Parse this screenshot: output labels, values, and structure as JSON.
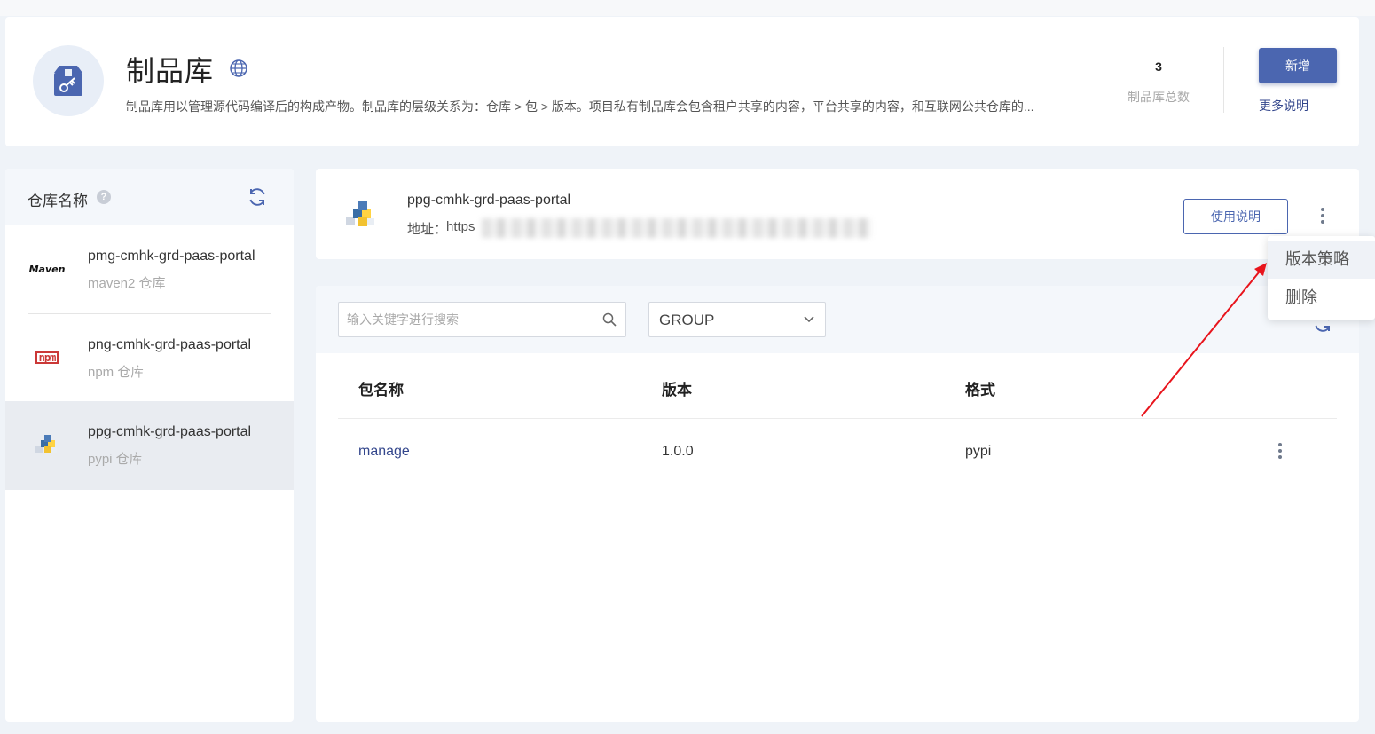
{
  "header": {
    "title": "制品库",
    "description": "制品库用以管理源代码编译后的构成产物。制品库的层级关系为：仓库 > 包 > 版本。项目私有制品库会包含租户共享的内容，平台共享的内容，和互联网公共仓库的...",
    "stat_value": "3",
    "stat_label": "制品库总数",
    "add_label": "新增",
    "more_label": "更多说明"
  },
  "sidebar": {
    "title": "仓库名称",
    "help": "?",
    "items": [
      {
        "name": "pmg-cmhk-grd-paas-portal",
        "type": "maven2 仓库",
        "logo": "Maven"
      },
      {
        "name": "png-cmhk-grd-paas-portal",
        "type": "npm 仓库",
        "logo": "npm"
      },
      {
        "name": "ppg-cmhk-grd-paas-portal",
        "type": "pypi 仓库",
        "logo": "python-icon"
      }
    ]
  },
  "repo_info": {
    "name": "ppg-cmhk-grd-paas-portal",
    "address_label": "地址：",
    "address_value": "https",
    "usage_label": "使用说明"
  },
  "dropdown": {
    "items": [
      "版本策略",
      "删除"
    ]
  },
  "packages": {
    "search_placeholder": "输入关键字进行搜索",
    "group_value": "GROUP",
    "columns": [
      "包名称",
      "版本",
      "格式"
    ],
    "rows": [
      {
        "name": "manage",
        "version": "1.0.0",
        "format": "pypi"
      }
    ]
  },
  "colors": {
    "primary": "#4b66b0",
    "link": "#33468c",
    "annotation_arrow": "#e8141c",
    "npm_red": "#cb3837"
  }
}
